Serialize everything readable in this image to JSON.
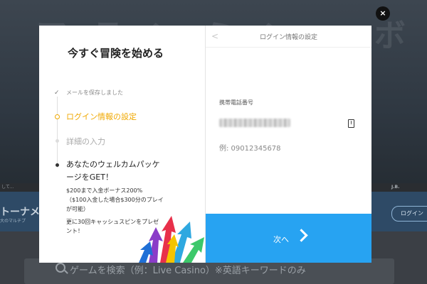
{
  "background": {
    "search_placeholder": "ゲームを検索（例：Live Casino）※英語キーワードのみ",
    "strip_left_text": "して...",
    "strip_right_text": "J.B.",
    "banner_title": "トーナメ",
    "banner_sub": "大のマルチプ",
    "login_button": "ログイン"
  },
  "modal": {
    "close_label": "×",
    "left": {
      "title": "今すぐ冒険を始める",
      "steps": [
        {
          "label": "メールを保存しました",
          "state": "done"
        },
        {
          "label": "ログイン情報の設定",
          "state": "current"
        },
        {
          "label": "詳細の入力",
          "state": "upcoming"
        }
      ],
      "welcome": {
        "line1": "あなたのウェルカムパッケ",
        "line2": "ージをGET！",
        "bonus_line1": "$200まで入金ボーナス200%",
        "bonus_line2": "（$100入金した場合$300分のプレイ",
        "bonus_line3": "が可能）",
        "spins_line1": "更に30回キャッシュスピンをプレゼ",
        "spins_line2": "ント！"
      }
    },
    "right": {
      "title": "ログイン情報の設定",
      "phone_label": "携帯電話番号",
      "phone_value": "",
      "phone_example": "例: 09012345678",
      "next_label": "次へ"
    }
  },
  "colors": {
    "accent": "#f0a800",
    "primary_button": "#27a3f2"
  }
}
